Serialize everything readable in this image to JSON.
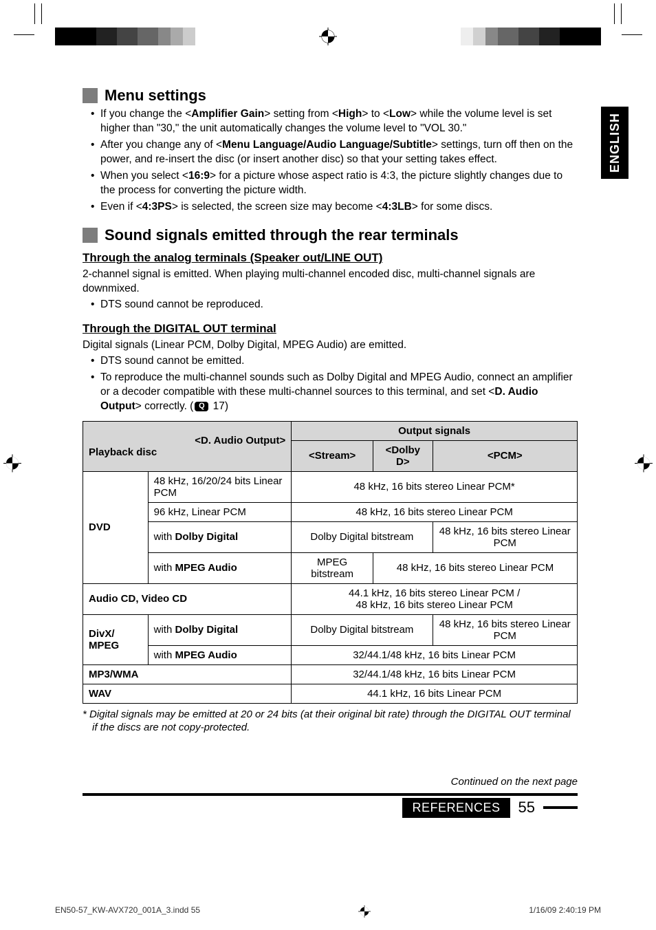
{
  "side_tab": "ENGLISH",
  "sections": {
    "menu": {
      "title": "Menu settings",
      "b1_a": "If you change the <",
      "b1_b": "Amplifier Gain",
      "b1_c": "> setting from <",
      "b1_d": "High",
      "b1_e": "> to <",
      "b1_f": "Low",
      "b1_g": "> while the volume level is set higher than \"30,\" the unit automatically changes the volume level to \"VOL 30.\"",
      "b2_a": "After you change any of <",
      "b2_b": "Menu Language/Audio Language/Subtitle",
      "b2_c": "> settings, turn off then on the power, and re-insert the disc (or insert another disc) so that your setting takes effect.",
      "b3_a": "When you select <",
      "b3_b": "16:9",
      "b3_c": "> for a picture whose aspect ratio is 4:3, the picture slightly changes due to the process for converting the picture width.",
      "b4_a": "Even if <",
      "b4_b": "4:3PS",
      "b4_c": "> is selected, the screen size may become <",
      "b4_d": "4:3LB",
      "b4_e": "> for some discs."
    },
    "sound": {
      "title": "Sound signals emitted through the rear terminals",
      "analog_head": "Through the analog terminals (Speaker out/LINE OUT)",
      "analog_p": "2-channel signal is emitted. When playing multi-channel encoded disc, multi-channel signals are downmixed.",
      "analog_b1": "DTS sound cannot be reproduced.",
      "digital_head": "Through the DIGITAL OUT terminal",
      "digital_p": "Digital signals (Linear PCM, Dolby Digital, MPEG Audio) are emitted.",
      "digital_b1": "DTS sound cannot be emitted.",
      "digital_b2_a": "To reproduce the multi-channel sounds such as Dolby Digital and MPEG Audio, connect an amplifier or a decoder compatible with these multi-channel sources to this terminal, and set <",
      "digital_b2_b": "D. Audio Output",
      "digital_b2_c": "> correctly. (",
      "digital_b2_d": " 17)"
    }
  },
  "table": {
    "head_dao": "<D. Audio Output>",
    "head_pb": "Playback disc",
    "head_out": "Output signals",
    "col_stream": "<Stream>",
    "col_dolby": "<Dolby D>",
    "col_pcm": "<PCM>",
    "dvd": "DVD",
    "dvd_r1_l": "48 kHz, 16/20/24 bits Linear PCM",
    "dvd_r1_v": "48 kHz, 16 bits stereo Linear PCM*",
    "dvd_r2_l": "96 kHz, Linear PCM",
    "dvd_r2_v": "48 kHz, 16 bits stereo Linear PCM",
    "dvd_r3_l_a": "with ",
    "dvd_r3_l_b": "Dolby Digital",
    "dvd_r3_v1": "Dolby Digital bitstream",
    "dvd_r3_v2": "48 kHz, 16 bits stereo Linear PCM",
    "dvd_r4_l_a": "with ",
    "dvd_r4_l_b": "MPEG Audio",
    "dvd_r4_v1": "MPEG bitstream",
    "dvd_r4_v2": "48 kHz, 16 bits stereo Linear PCM",
    "acd_l": "Audio CD, Video CD",
    "acd_v1": "44.1 kHz, 16 bits stereo Linear PCM /",
    "acd_v2": "48 kHz, 16 bits stereo Linear PCM",
    "divx": "DivX/ MPEG",
    "divx_r1_l_a": "with ",
    "divx_r1_l_b": "Dolby Digital",
    "divx_r1_v1": "Dolby Digital bitstream",
    "divx_r1_v2": "48 kHz, 16 bits stereo Linear PCM",
    "divx_r2_l_a": "with ",
    "divx_r2_l_b": "MPEG Audio",
    "divx_r2_v": "32/44.1/48 kHz, 16 bits Linear PCM",
    "mp3_l": "MP3/WMA",
    "mp3_v": "32/44.1/48 kHz, 16 bits Linear PCM",
    "wav_l": "WAV",
    "wav_v": "44.1 kHz, 16 bits Linear PCM"
  },
  "footnote": "*  Digital signals may be emitted at 20 or 24 bits (at their original bit rate) through the DIGITAL OUT terminal if the discs are not copy-protected.",
  "continued": "Continued on the next page",
  "footer": {
    "label": "REFERENCES",
    "page": "55"
  },
  "print": {
    "left": "EN50-57_KW-AVX720_001A_3.indd   55",
    "right": "1/16/09   2:40:19 PM"
  },
  "q_icon": "Q"
}
